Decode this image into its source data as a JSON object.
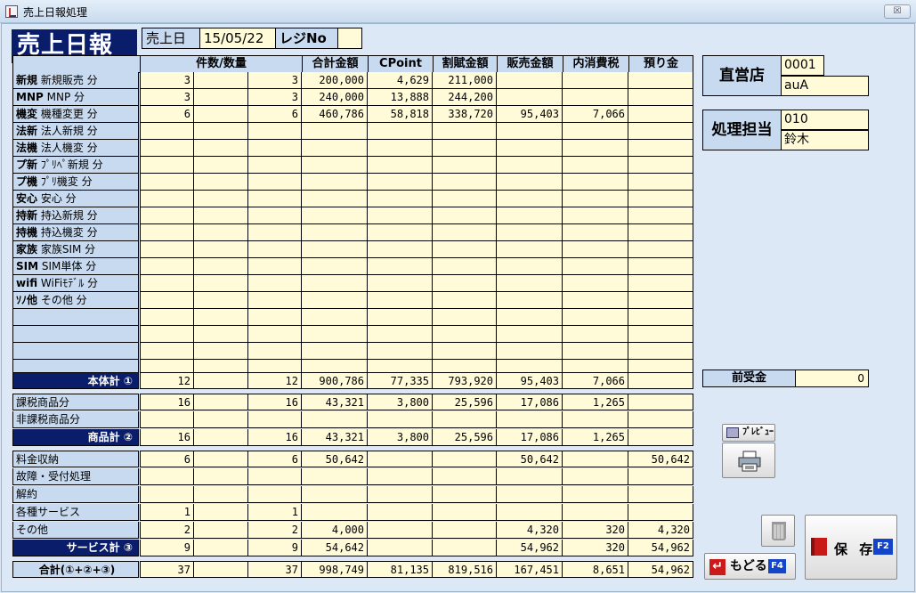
{
  "window": {
    "title": "売上日報処理",
    "close_label": "☒"
  },
  "header": {
    "page_title": "売上日報",
    "date_label": "売上日",
    "date_value": "15/05/22",
    "register_label": "レジNo",
    "register_value": ""
  },
  "columns": [
    "件数/数量",
    "合計金額",
    "CPoint",
    "割賦金額",
    "販売金額",
    "内消費税",
    "預り金"
  ],
  "section1": {
    "rows": [
      {
        "code": "新規",
        "label": "新規販売 分",
        "c1": "3",
        "c2": "",
        "c3": "3",
        "total": "200,000",
        "cpoint": "4,629",
        "installment": "211,000",
        "sales": "",
        "tax": "",
        "deposit": ""
      },
      {
        "code": "MNP",
        "label": "MNP 分",
        "c1": "3",
        "c2": "",
        "c3": "3",
        "total": "240,000",
        "cpoint": "13,888",
        "installment": "244,200",
        "sales": "",
        "tax": "",
        "deposit": ""
      },
      {
        "code": "機変",
        "label": "機種変更 分",
        "c1": "6",
        "c2": "",
        "c3": "6",
        "total": "460,786",
        "cpoint": "58,818",
        "installment": "338,720",
        "sales": "95,403",
        "tax": "7,066",
        "deposit": ""
      },
      {
        "code": "法新",
        "label": "法人新規 分",
        "c1": "",
        "c2": "",
        "c3": "",
        "total": "",
        "cpoint": "",
        "installment": "",
        "sales": "",
        "tax": "",
        "deposit": ""
      },
      {
        "code": "法機",
        "label": "法人機変 分",
        "c1": "",
        "c2": "",
        "c3": "",
        "total": "",
        "cpoint": "",
        "installment": "",
        "sales": "",
        "tax": "",
        "deposit": ""
      },
      {
        "code": "プ新",
        "label": "ﾌﾟﾘﾍﾟ新規 分",
        "c1": "",
        "c2": "",
        "c3": "",
        "total": "",
        "cpoint": "",
        "installment": "",
        "sales": "",
        "tax": "",
        "deposit": ""
      },
      {
        "code": "プ機",
        "label": "ﾌﾟﾘ機変 分",
        "c1": "",
        "c2": "",
        "c3": "",
        "total": "",
        "cpoint": "",
        "installment": "",
        "sales": "",
        "tax": "",
        "deposit": ""
      },
      {
        "code": "安心",
        "label": "安心 分",
        "c1": "",
        "c2": "",
        "c3": "",
        "total": "",
        "cpoint": "",
        "installment": "",
        "sales": "",
        "tax": "",
        "deposit": ""
      },
      {
        "code": "持新",
        "label": "持込新規 分",
        "c1": "",
        "c2": "",
        "c3": "",
        "total": "",
        "cpoint": "",
        "installment": "",
        "sales": "",
        "tax": "",
        "deposit": ""
      },
      {
        "code": "持機",
        "label": "持込機変 分",
        "c1": "",
        "c2": "",
        "c3": "",
        "total": "",
        "cpoint": "",
        "installment": "",
        "sales": "",
        "tax": "",
        "deposit": ""
      },
      {
        "code": "家族",
        "label": "家族SIM 分",
        "c1": "",
        "c2": "",
        "c3": "",
        "total": "",
        "cpoint": "",
        "installment": "",
        "sales": "",
        "tax": "",
        "deposit": ""
      },
      {
        "code": "SIM",
        "label": "SIM単体 分",
        "c1": "",
        "c2": "",
        "c3": "",
        "total": "",
        "cpoint": "",
        "installment": "",
        "sales": "",
        "tax": "",
        "deposit": ""
      },
      {
        "code": "wifi",
        "label": "WiFiﾓﾃﾞﾙ 分",
        "c1": "",
        "c2": "",
        "c3": "",
        "total": "",
        "cpoint": "",
        "installment": "",
        "sales": "",
        "tax": "",
        "deposit": ""
      },
      {
        "code": "ｿﾉ他",
        "label": "その他 分",
        "c1": "",
        "c2": "",
        "c3": "",
        "total": "",
        "cpoint": "",
        "installment": "",
        "sales": "",
        "tax": "",
        "deposit": ""
      },
      {
        "code": "",
        "label": "",
        "c1": "",
        "c2": "",
        "c3": "",
        "total": "",
        "cpoint": "",
        "installment": "",
        "sales": "",
        "tax": "",
        "deposit": ""
      },
      {
        "code": "",
        "label": "",
        "c1": "",
        "c2": "",
        "c3": "",
        "total": "",
        "cpoint": "",
        "installment": "",
        "sales": "",
        "tax": "",
        "deposit": ""
      },
      {
        "code": "",
        "label": "",
        "c1": "",
        "c2": "",
        "c3": "",
        "total": "",
        "cpoint": "",
        "installment": "",
        "sales": "",
        "tax": "",
        "deposit": ""
      },
      {
        "code": "",
        "label": "",
        "c1": "",
        "c2": "",
        "c3": "",
        "total": "",
        "cpoint": "",
        "installment": "",
        "sales": "",
        "tax": "",
        "deposit": ""
      }
    ],
    "subtotal": {
      "label": "本体計 ①",
      "c1": "12",
      "c2": "",
      "c3": "12",
      "total": "900,786",
      "cpoint": "77,335",
      "installment": "793,920",
      "sales": "95,403",
      "tax": "7,066",
      "deposit": ""
    }
  },
  "section2": {
    "rows": [
      {
        "label": "課税商品分",
        "c1": "16",
        "c2": "",
        "c3": "16",
        "total": "43,321",
        "cpoint": "3,800",
        "installment": "25,596",
        "sales": "17,086",
        "tax": "1,265",
        "deposit": ""
      },
      {
        "label": "非課税商品分",
        "c1": "",
        "c2": "",
        "c3": "",
        "total": "",
        "cpoint": "",
        "installment": "",
        "sales": "",
        "tax": "",
        "deposit": ""
      }
    ],
    "subtotal": {
      "label": "商品計 ②",
      "c1": "16",
      "c2": "",
      "c3": "16",
      "total": "43,321",
      "cpoint": "3,800",
      "installment": "25,596",
      "sales": "17,086",
      "tax": "1,265",
      "deposit": ""
    }
  },
  "section3": {
    "rows": [
      {
        "label": "料金収納",
        "c1": "6",
        "c2": "",
        "c3": "6",
        "total": "50,642",
        "cpoint": "",
        "installment": "",
        "sales": "50,642",
        "tax": "",
        "deposit": "50,642"
      },
      {
        "label": "故障・受付処理",
        "c1": "",
        "c2": "",
        "c3": "",
        "total": "",
        "cpoint": "",
        "installment": "",
        "sales": "",
        "tax": "",
        "deposit": ""
      },
      {
        "label": "解約",
        "c1": "",
        "c2": "",
        "c3": "",
        "total": "",
        "cpoint": "",
        "installment": "",
        "sales": "",
        "tax": "",
        "deposit": ""
      },
      {
        "label": "各種サービス",
        "c1": "1",
        "c2": "",
        "c3": "1",
        "total": "",
        "cpoint": "",
        "installment": "",
        "sales": "",
        "tax": "",
        "deposit": ""
      },
      {
        "label": "その他",
        "c1": "2",
        "c2": "",
        "c3": "2",
        "total": "4,000",
        "cpoint": "",
        "installment": "",
        "sales": "4,320",
        "tax": "320",
        "deposit": "4,320"
      }
    ],
    "subtotal": {
      "label": "サービス計 ③",
      "c1": "9",
      "c2": "",
      "c3": "9",
      "total": "54,642",
      "cpoint": "",
      "installment": "",
      "sales": "54,962",
      "tax": "320",
      "deposit": "54,962"
    }
  },
  "grand_total": {
    "label": "合計(①+②+③)",
    "c1": "37",
    "c2": "",
    "c3": "37",
    "total": "998,749",
    "cpoint": "81,135",
    "installment": "819,516",
    "sales": "167,451",
    "tax": "8,651",
    "deposit": "54,962"
  },
  "store": {
    "label": "直営店",
    "code": "0001",
    "name": "auA"
  },
  "staff": {
    "label": "処理担当",
    "code": "010",
    "name": "鈴木"
  },
  "advance": {
    "label": "前受金",
    "value": "0"
  },
  "buttons": {
    "preview": "ﾌﾟﾚﾋﾞｭｰ",
    "back": "もどる",
    "back_key": "F4",
    "save": "保 存",
    "save_key": "F2"
  }
}
